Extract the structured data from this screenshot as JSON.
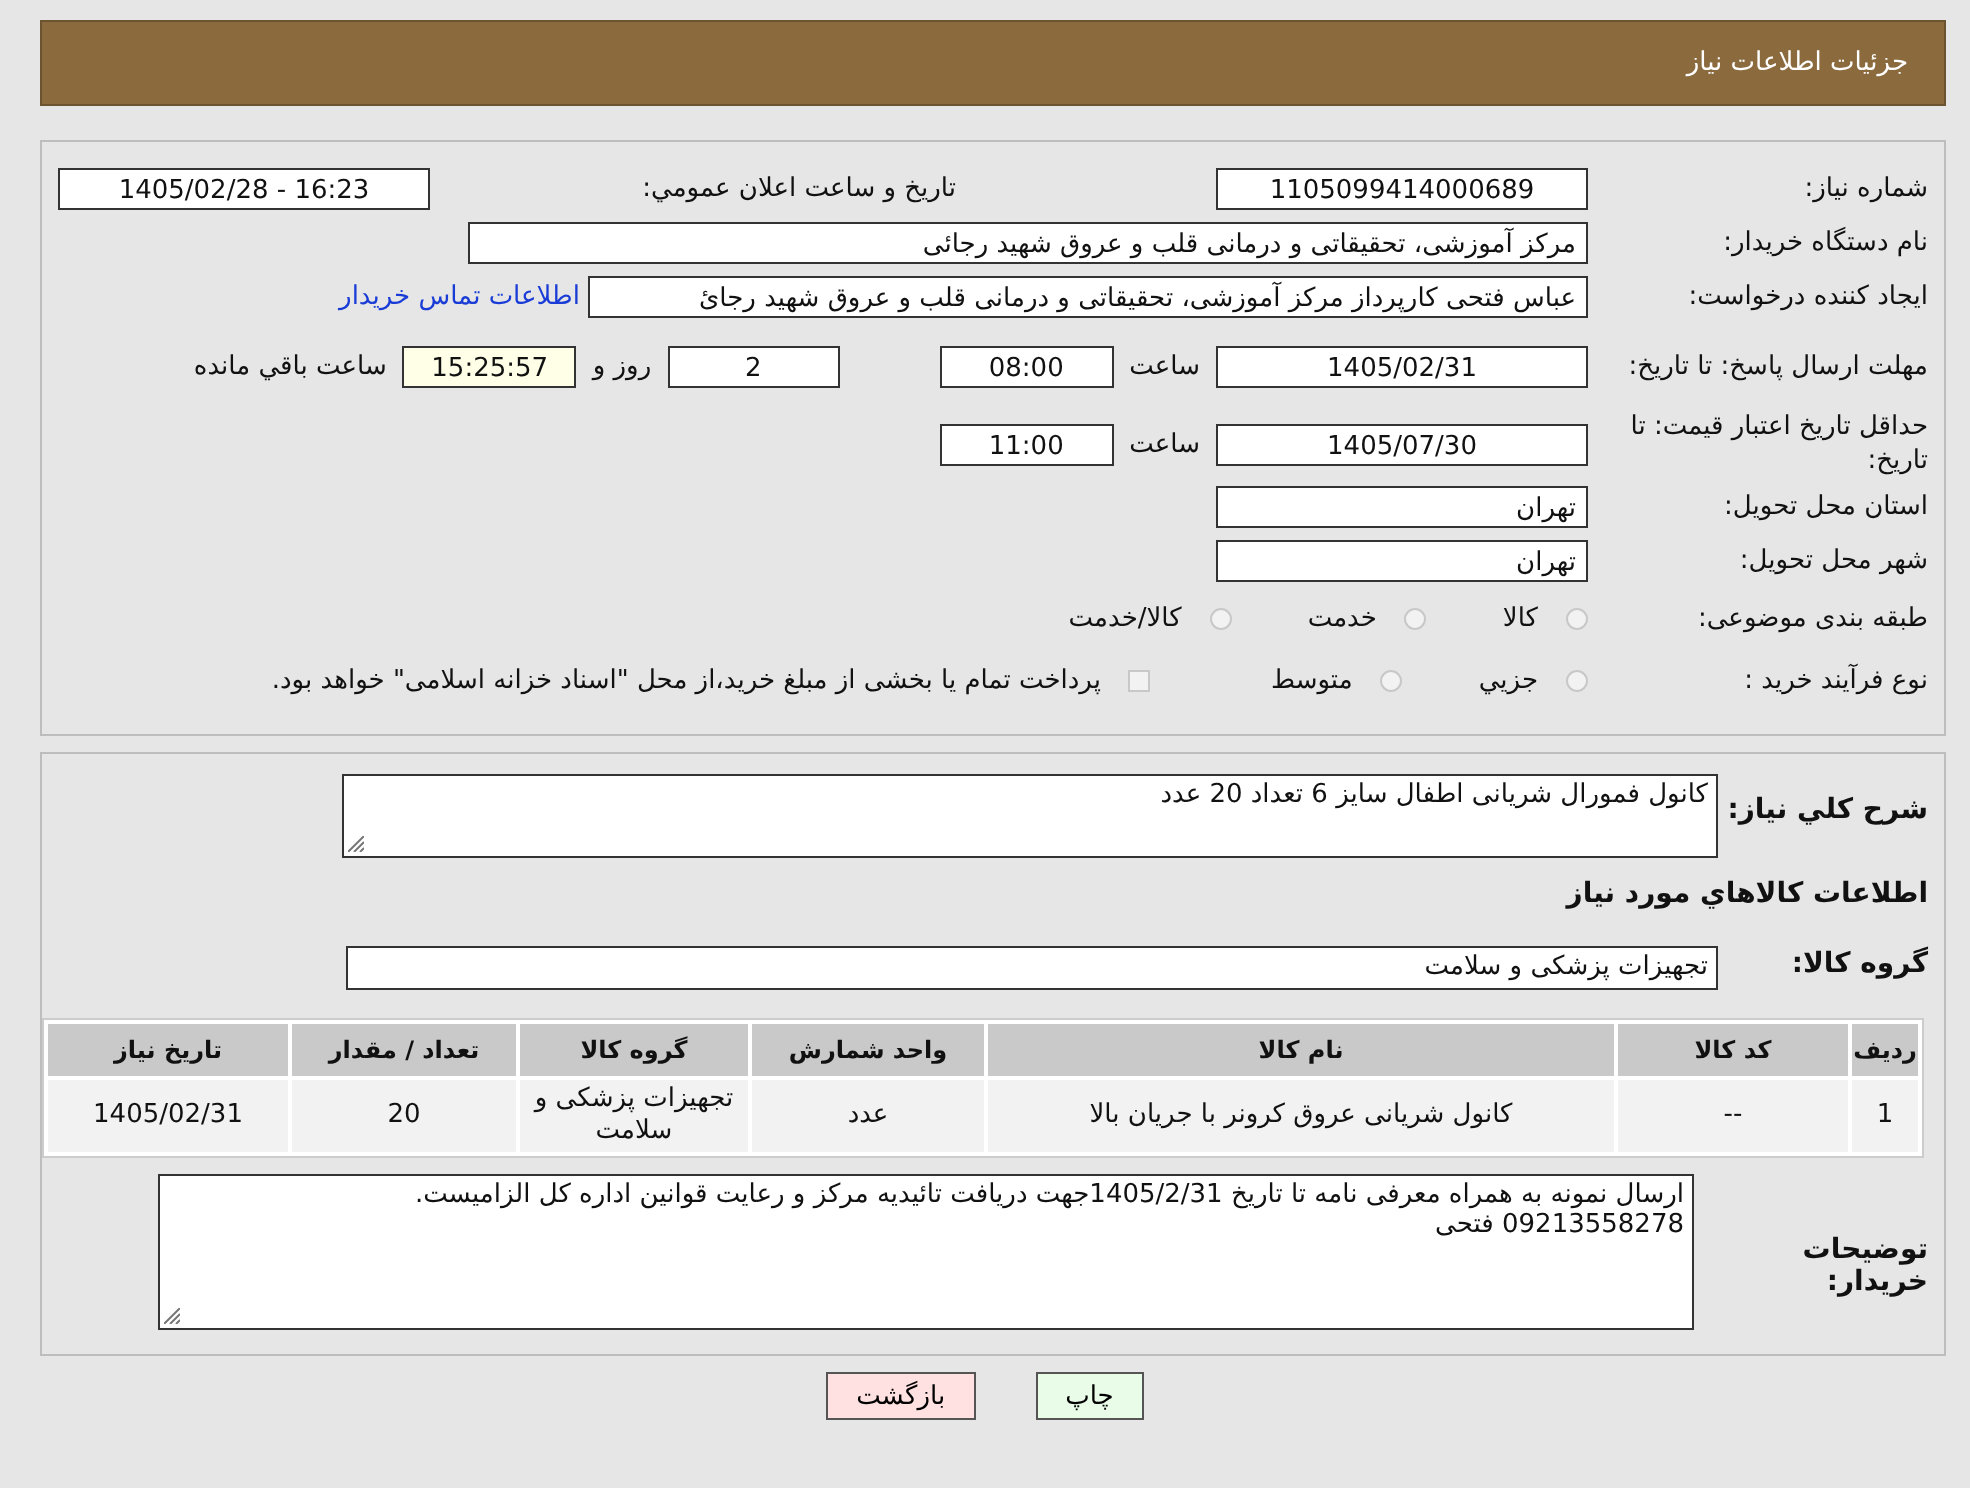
{
  "header": {
    "title": "جزئیات اطلاعات نیاز"
  },
  "need_number": {
    "label": "شماره نیاز:",
    "value": "1105099414000689"
  },
  "announce": {
    "label": "تاریخ و ساعت اعلان عمومي:",
    "value": "1405/02/28 - 16:23"
  },
  "buyer_org": {
    "label": "نام دستگاه خریدار:",
    "value": "مرکز آموزشی، تحقیقاتی و درمانی قلب و عروق شهید رجائی"
  },
  "requester": {
    "label": "ایجاد کننده درخواست:",
    "value": "عباس فتحی کارپرداز مرکز آموزشی، تحقیقاتی و درمانی قلب و عروق شهید رجائ",
    "link": "اطلاعات تماس خریدار"
  },
  "deadline": {
    "label": "مهلت ارسال پاسخ: تا تاریخ:",
    "date": "1405/02/31",
    "time_label": "ساعت",
    "time": "08:00",
    "days": "2",
    "days_label": "روز و",
    "remaining": "15:25:57",
    "remaining_label": "ساعت باقي مانده"
  },
  "validity": {
    "label": "حداقل تاریخ اعتبار قیمت: تا تاریخ:",
    "date": "1405/07/30",
    "time_label": "ساعت",
    "time": "11:00"
  },
  "province": {
    "label": "استان محل تحویل:",
    "value": "تهران"
  },
  "city": {
    "label": "شهر محل تحویل:",
    "value": "تهران"
  },
  "category": {
    "label": "طبقه بندی موضوعی:",
    "options": [
      {
        "label": "کالا",
        "selected": false
      },
      {
        "label": "خدمت",
        "selected": false
      },
      {
        "label": "کالا/خدمت",
        "selected": false
      }
    ]
  },
  "process": {
    "label": "نوع فرآیند خرید :",
    "options": [
      {
        "kind": "radio",
        "label": "جزيي",
        "selected": false
      },
      {
        "kind": "radio",
        "label": "متوسط",
        "selected": false
      },
      {
        "kind": "checkbox",
        "label": "پرداخت تمام یا بخشی از مبلغ خرید،از محل \"اسناد خزانه اسلامی\" خواهد بود.",
        "checked": false
      }
    ]
  },
  "description": {
    "label": "شرح كلي نياز:",
    "value": "کانول فمورال شریانی اطفال سایز 6 تعداد 20 عدد"
  },
  "goods_heading": "اطلاعات كالاهاي مورد نياز",
  "goods_group": {
    "label": "گروه کالا:",
    "value": "تجهیزات پزشکی و سلامت"
  },
  "table": {
    "columns": [
      "ردیف",
      "کد کالا",
      "نام کالا",
      "واحد شمارش",
      "گروه کالا",
      "تعداد / مقدار",
      "تاریخ نیاز"
    ],
    "rows": [
      [
        "1",
        "--",
        "کانول شریانی عروق کرونر با جریان بالا",
        "عدد",
        "تجهیزات پزشکی و سلامت",
        "20",
        "1405/02/31"
      ]
    ]
  },
  "buyer_notes": {
    "label": "توضیحات خریدار:",
    "value": "ارسال نمونه به همراه معرفی نامه تا تاریخ 1405/2/31جهت دریافت تائیدیه مرکز و رعایت قوانین اداره کل الزامیست.\n09213558278 فتحی"
  },
  "buttons": [
    {
      "kind": "print",
      "label": "چاپ"
    },
    {
      "kind": "back",
      "label": "بازگشت"
    }
  ]
}
